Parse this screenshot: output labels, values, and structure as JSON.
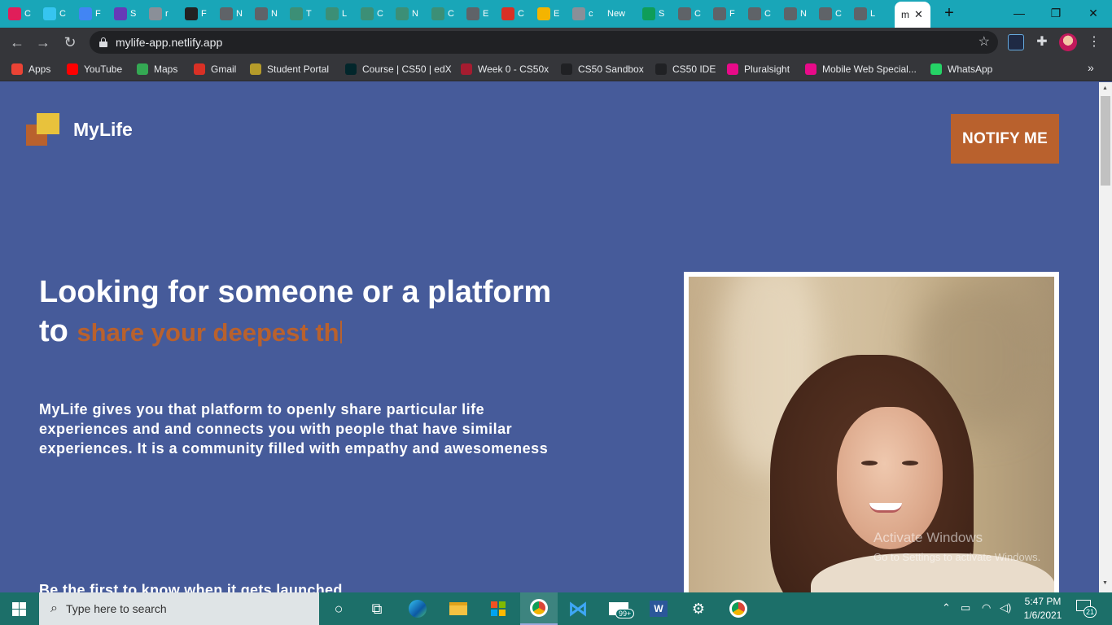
{
  "browser": {
    "tabs": [
      {
        "short": "C",
        "color": "#e01e5a"
      },
      {
        "short": "C",
        "color": "#36c5f0"
      },
      {
        "short": "F",
        "color": "#4285f4"
      },
      {
        "short": "S",
        "color": "#673ab7"
      },
      {
        "short": "r",
        "color": "#8a8f98"
      },
      {
        "short": "F",
        "color": "#222222"
      },
      {
        "short": "N",
        "color": "#5f6368"
      },
      {
        "short": "N",
        "color": "#5f6368"
      },
      {
        "short": "T",
        "color": "#3c8f76"
      },
      {
        "short": "L",
        "color": "#3c8f76"
      },
      {
        "short": "C",
        "color": "#3c8f76"
      },
      {
        "short": "N",
        "color": "#3c8f76"
      },
      {
        "short": "C",
        "color": "#3c8f76"
      },
      {
        "short": "E",
        "color": "#5f6368"
      },
      {
        "short": "C",
        "color": "#d93025"
      },
      {
        "short": "E",
        "color": "#f4b400"
      },
      {
        "short": "c",
        "color": "#8a8f98"
      },
      {
        "short": "New",
        "color": ""
      },
      {
        "short": "S",
        "color": "#0f9d58"
      },
      {
        "short": "C",
        "color": "#5f6368"
      },
      {
        "short": "F",
        "color": "#5f6368"
      },
      {
        "short": "C",
        "color": "#5f6368"
      },
      {
        "short": "N",
        "color": "#5f6368"
      },
      {
        "short": "C",
        "color": "#5f6368"
      },
      {
        "short": "L",
        "color": "#5f6368"
      }
    ],
    "active_tab": {
      "short": "m"
    },
    "url": "mylife-app.netlify.app",
    "bookmarks": [
      {
        "label": "Apps",
        "color": "#ea4335"
      },
      {
        "label": "YouTube",
        "color": "#ff0000"
      },
      {
        "label": "Maps",
        "color": "#34a853"
      },
      {
        "label": "Gmail",
        "color": "#d93025"
      },
      {
        "label": "Student Portal",
        "color": "#b59b2a"
      },
      {
        "label": "Course | CS50 | edX",
        "color": "#02262b"
      },
      {
        "label": "Week 0 - CS50x",
        "color": "#a51c30"
      },
      {
        "label": "CS50 Sandbox",
        "color": "#202124"
      },
      {
        "label": "CS50 IDE",
        "color": "#202124"
      },
      {
        "label": "Pluralsight",
        "color": "#e80a89"
      },
      {
        "label": "Mobile Web Special...",
        "color": "#e80a89"
      },
      {
        "label": "WhatsApp",
        "color": "#25d366"
      }
    ]
  },
  "page": {
    "brand": "MyLife",
    "notify_label": "NOTIFY ME",
    "hero_line1": "Looking for someone or a platform",
    "hero_to": "to",
    "hero_typed": "share your deepest th",
    "description": "MyLife gives you that platform to openly share particular life experiences and and connects you with people that have similar experiences. It is a community filled with empathy and awesomeness",
    "launch_text": "Be the first to know when it gets launched",
    "watermark_line1": "Activate Windows",
    "watermark_line2": "Go to Settings to activate Windows.",
    "colors": {
      "background": "#465b9a",
      "accent": "#b9612d",
      "logo_yellow": "#e8c23c"
    }
  },
  "taskbar": {
    "search_placeholder": "Type here to search",
    "mail_badge": "99+",
    "time": "5:47 PM",
    "date": "1/6/2021",
    "notification_count": "21"
  }
}
